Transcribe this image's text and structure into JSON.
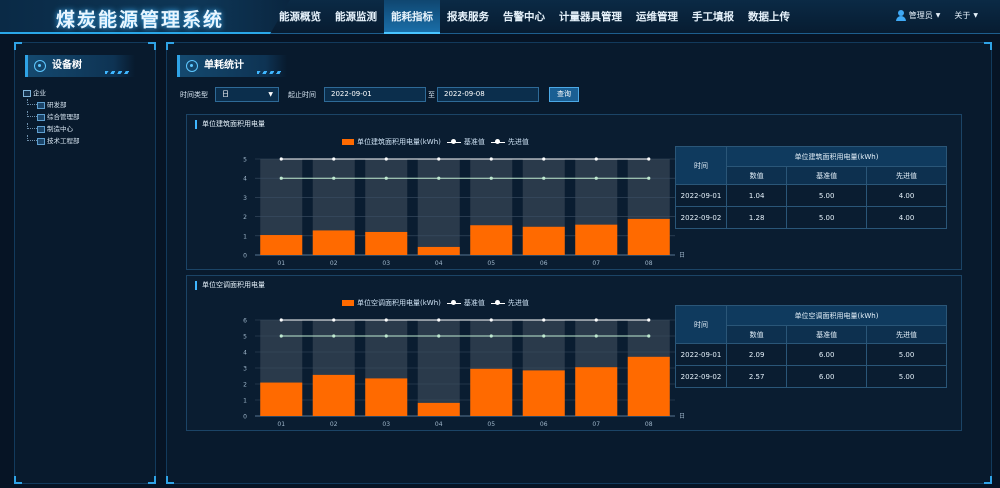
{
  "app": {
    "title": "煤炭能源管理系统"
  },
  "nav": {
    "items": [
      {
        "label": "能源概览",
        "active": false
      },
      {
        "label": "能源监测",
        "active": false
      },
      {
        "label": "能耗指标",
        "active": true
      },
      {
        "label": "报表服务",
        "active": false
      },
      {
        "label": "告警中心",
        "active": false
      },
      {
        "label": "计量器具管理",
        "active": false
      },
      {
        "label": "运维管理",
        "active": false
      },
      {
        "label": "手工填报",
        "active": false
      },
      {
        "label": "数据上传",
        "active": false
      }
    ]
  },
  "user": {
    "name": "管理员",
    "about": "关于"
  },
  "sidebar": {
    "title": "设备树",
    "root": "企业",
    "children": [
      "研发部",
      "综合管理部",
      "制造中心",
      "技术工程部"
    ]
  },
  "main": {
    "title": "单耗统计",
    "filter": {
      "time_type_label": "时间类型",
      "time_type_value": "日",
      "range_label": "起止时间",
      "start_date": "2022-09-01",
      "to_label": "至",
      "end_date": "2022-09-08",
      "query_label": "查询"
    }
  },
  "colors": {
    "bar": "#ff6a00",
    "accent": "#2fa3e6",
    "background": "#061425"
  },
  "chart_data": [
    {
      "type": "bar",
      "title": "单位建筑面积用电量",
      "categories": [
        "01",
        "02",
        "03",
        "04",
        "05",
        "06",
        "07",
        "08"
      ],
      "xlabel": "日",
      "ylim": [
        0,
        5
      ],
      "yticks": [
        0,
        1,
        2,
        3,
        4,
        5
      ],
      "series": [
        {
          "name": "单位建筑面积用电量(kWh)",
          "kind": "bar",
          "values": [
            1.04,
            1.28,
            1.2,
            0.42,
            1.55,
            1.47,
            1.58,
            1.88
          ]
        },
        {
          "name": "基准值",
          "kind": "line",
          "values": [
            5,
            5,
            5,
            5,
            5,
            5,
            5,
            5
          ]
        },
        {
          "name": "先进值",
          "kind": "line",
          "values": [
            4,
            4,
            4,
            4,
            4,
            4,
            4,
            4
          ]
        }
      ],
      "table": {
        "time_header": "时间",
        "group_header": "单位建筑面积用电量(kWh)",
        "columns": [
          "数值",
          "基准值",
          "先进值"
        ],
        "rows": [
          {
            "date": "2022-09-01",
            "value": "1.04",
            "base": "5.00",
            "adv": "4.00"
          },
          {
            "date": "2022-09-02",
            "value": "1.28",
            "base": "5.00",
            "adv": "4.00"
          }
        ]
      }
    },
    {
      "type": "bar",
      "title": "单位空调面积用电量",
      "categories": [
        "01",
        "02",
        "03",
        "04",
        "05",
        "06",
        "07",
        "08"
      ],
      "xlabel": "日",
      "ylim": [
        0,
        6
      ],
      "yticks": [
        0,
        1,
        2,
        3,
        4,
        5,
        6
      ],
      "series": [
        {
          "name": "单位空调面积用电量(kWh)",
          "kind": "bar",
          "values": [
            2.09,
            2.57,
            2.35,
            0.82,
            2.95,
            2.85,
            3.05,
            3.7
          ]
        },
        {
          "name": "基准值",
          "kind": "line",
          "values": [
            6,
            6,
            6,
            6,
            6,
            6,
            6,
            6
          ]
        },
        {
          "name": "先进值",
          "kind": "line",
          "values": [
            5,
            5,
            5,
            5,
            5,
            5,
            5,
            5
          ]
        }
      ],
      "table": {
        "time_header": "时间",
        "group_header": "单位空调面积用电量(kWh)",
        "columns": [
          "数值",
          "基准值",
          "先进值"
        ],
        "rows": [
          {
            "date": "2022-09-01",
            "value": "2.09",
            "base": "6.00",
            "adv": "5.00"
          },
          {
            "date": "2022-09-02",
            "value": "2.57",
            "base": "6.00",
            "adv": "5.00"
          }
        ]
      }
    }
  ]
}
